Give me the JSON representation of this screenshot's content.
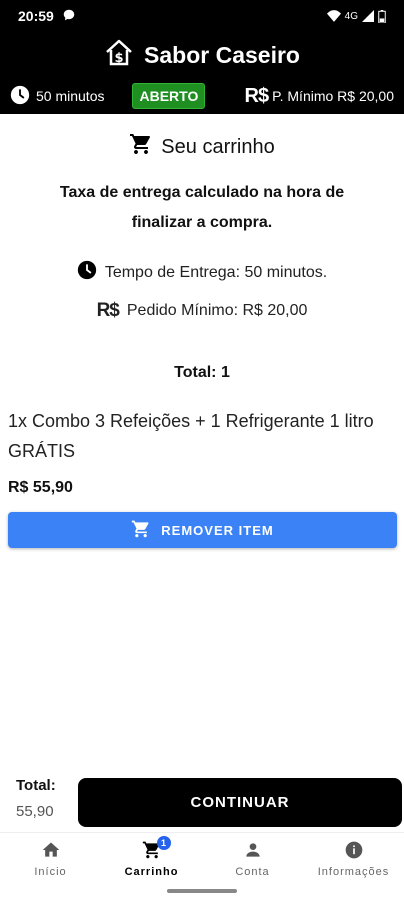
{
  "status_bar": {
    "time": "20:59",
    "network": "4G"
  },
  "app": {
    "name": "Sabor Caseiro"
  },
  "info_bar": {
    "delivery_time": "50 minutos",
    "status": "ABERTO",
    "min_order": "P. Mínimo R$ 20,00"
  },
  "cart": {
    "title": "Seu carrinho",
    "tax_note": "Taxa de entrega calculado na hora de finalizar a compra.",
    "delivery_time_line": "Tempo de Entrega: 50 minutos.",
    "min_order_line": "Pedido Mínimo: R$ 20,00",
    "total_count": "Total: 1",
    "items": [
      {
        "name": "1x Combo 3 Refeições + 1 Refrigerante 1 litro GRÁTIS",
        "price": "R$ 55,90",
        "remove_label": "REMOVER ITEM"
      }
    ]
  },
  "footer": {
    "total_label": "Total:",
    "total_value": "55,90",
    "continue_label": "CONTINUAR"
  },
  "bottom_nav": {
    "items": [
      {
        "label": "Início",
        "icon": "home-icon"
      },
      {
        "label": "Carrinho",
        "icon": "cart-icon",
        "badge": "1"
      },
      {
        "label": "Conta",
        "icon": "person-icon"
      },
      {
        "label": "Informações",
        "icon": "info-icon"
      }
    ]
  },
  "colors": {
    "accent_blue": "#3b82f6",
    "open_green": "#1f8f22",
    "header_black": "#000000"
  }
}
